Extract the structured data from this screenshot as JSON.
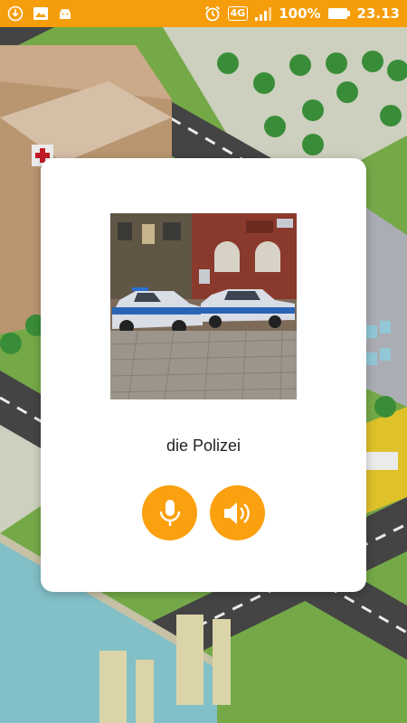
{
  "status_bar": {
    "network": "4G",
    "battery_percent": "100%",
    "time": "23.13",
    "background_color": "#f59d0a"
  },
  "card": {
    "image_alt": "photo-police-cars",
    "word": "die Polizei",
    "buttons": [
      {
        "name": "microphone",
        "icon": "mic-icon"
      },
      {
        "name": "speaker",
        "icon": "speaker-icon"
      }
    ],
    "accent_color": "#fba00e"
  },
  "background": {
    "scene": "isometric-city-map"
  }
}
